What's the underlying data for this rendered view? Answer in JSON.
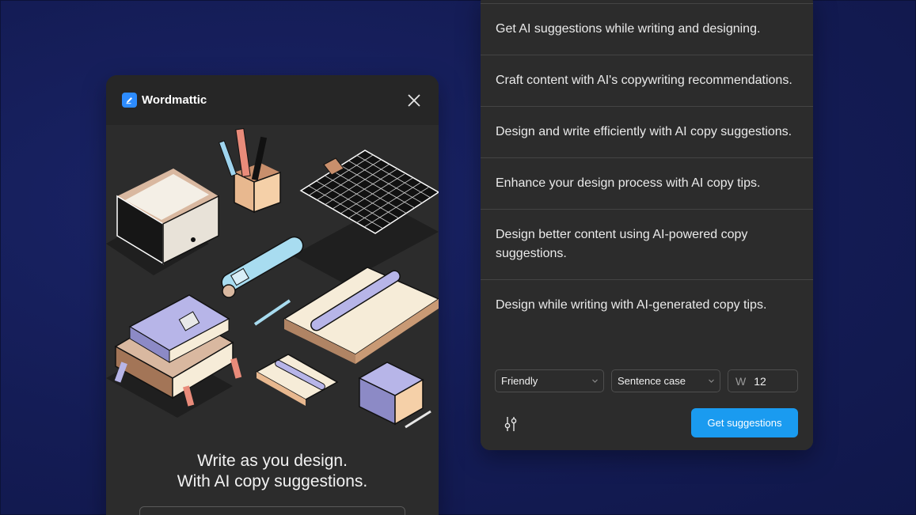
{
  "plugin": {
    "brand_name": "Wordmattic",
    "brand_icon": "pen-icon",
    "close_icon": "close-icon",
    "tagline_line1": "Write as you design.",
    "tagline_line2": "With AI copy suggestions."
  },
  "panel": {
    "suggestions": [
      "Get AI suggestions while writing and designing.",
      "Craft content with AI's copywriting recommendations.",
      "Design and write efficiently with AI copy suggestions.",
      "Enhance your design process with AI copy tips.",
      "Design better content using AI-powered copy suggestions.",
      "Design while writing with AI-generated copy tips."
    ],
    "tone_value": "Friendly",
    "case_value": "Sentence case",
    "word_prefix": "W",
    "word_count": "12",
    "settings_icon": "sliders-icon",
    "get_button_label": "Get suggestions"
  },
  "colors": {
    "background": "#141c55",
    "window": "#2c2c2c",
    "accent": "#1a9bf0",
    "brand": "#2d8cff"
  }
}
